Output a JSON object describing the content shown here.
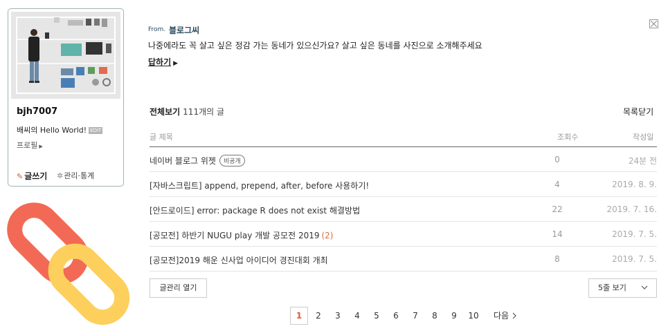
{
  "profile": {
    "nickname": "bjh7007",
    "blog_name": "배씨의 Hello World!",
    "edit_badge": "EDIT",
    "profile_link": "프로필",
    "write_label": "글쓰기",
    "manage_label": "관리·통계"
  },
  "message": {
    "from_label": "From.",
    "from_name": "블로그씨",
    "text": "나중에라도 꼭 살고 싶은 정감 가는 동네가 있으신가요? 살고 싶은 동네를 사진으로 소개해주세요",
    "reply_label": "답하기"
  },
  "list": {
    "title": "전체보기",
    "count": "111개의 글",
    "close_label": "목록닫기",
    "columns": {
      "title": "글 제목",
      "views": "조회수",
      "date": "작성일"
    },
    "rows": [
      {
        "title": "네이버 블로그 위젯",
        "badge": "비공개",
        "comments": "",
        "views": "0",
        "date": "24분 전"
      },
      {
        "title": "[자바스크립트] append, prepend, after, before 사용하기!",
        "badge": "",
        "comments": "",
        "views": "4",
        "date": "2019. 8. 9."
      },
      {
        "title": "[안드로이드] error: package R does not exist 해결방법",
        "badge": "",
        "comments": "",
        "views": "22",
        "date": "2019. 7. 16."
      },
      {
        "title": "[공모전] 하반기 NUGU play 개발 공모전 2019",
        "badge": "",
        "comments": "(2)",
        "views": "14",
        "date": "2019. 7. 5."
      },
      {
        "title": "[공모전]2019 해운 신사업 아이디어 경진대회 개최",
        "badge": "",
        "comments": "",
        "views": "8",
        "date": "2019. 7. 5."
      }
    ]
  },
  "controls": {
    "manage_open_label": "글관리 열기",
    "lines_label": "5줄 보기"
  },
  "pagination": {
    "pages": [
      "1",
      "2",
      "3",
      "4",
      "5",
      "6",
      "7",
      "8",
      "9",
      "10"
    ],
    "current": "1",
    "next_label": "다음"
  },
  "colors": {
    "accent": "#e05a2c",
    "link_icon_red": "#f26a55",
    "link_icon_yellow": "#fdd05e"
  }
}
